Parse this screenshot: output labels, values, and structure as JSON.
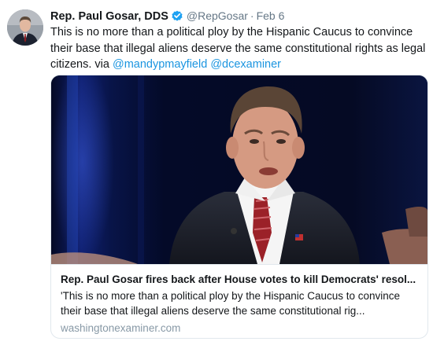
{
  "tweet": {
    "author_name": "Rep. Paul Gosar, DDS",
    "handle": "@RepGosar",
    "separator": "·",
    "date": "Feb 6",
    "text": "This is no more than a political ploy by the Hispanic Caucus to convince their base that illegal aliens deserve the same constitutional rights as legal citizens. via ",
    "mentions": [
      "@mandypmayfield",
      "@dcexaminer"
    ],
    "verified_icon": "verified-badge-icon",
    "colors": {
      "link": "#1b95e0",
      "secondary": "#657786",
      "border": "#e1e8ed"
    }
  },
  "card": {
    "title": "Rep. Paul Gosar fires back after House votes to kill Democrats' resol...",
    "description": "'This is no more than a political ploy by the Hispanic Caucus to convince their base that illegal aliens deserve the same constitutional rig...",
    "domain": "washingtonexaminer.com"
  }
}
